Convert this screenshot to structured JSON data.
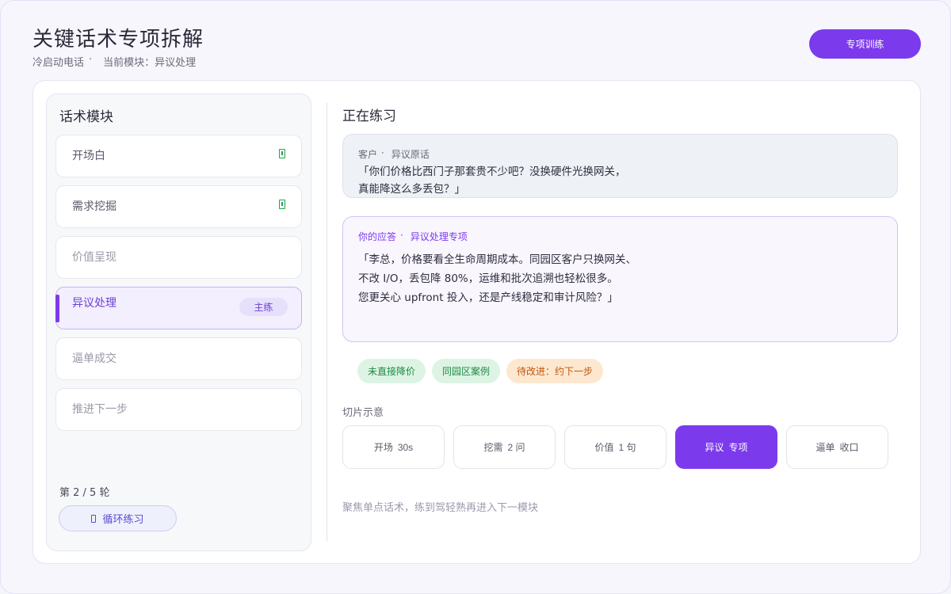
{
  "header": {
    "title": "关键话术专项拆解",
    "breadcrumb": [
      "冷启动电话",
      "当前模块：异议处理"
    ],
    "breadcrumb_sep": "·",
    "train_button": "专项训练"
  },
  "sidebar": {
    "title": "话术模块",
    "items": [
      {
        "label": "开场白",
        "state": "done",
        "icon": "phone-check-icon"
      },
      {
        "label": "需求挖掘",
        "state": "done",
        "icon": "phone-check-icon"
      },
      {
        "label": "价值呈现",
        "state": "pending"
      },
      {
        "label": "异议处理",
        "state": "active",
        "badge": "主练"
      },
      {
        "label": "逼单成交",
        "state": "pending"
      },
      {
        "label": "推进下一步",
        "state": "pending"
      }
    ],
    "round": "第 2 / 5 轮",
    "loop_button": "循环练习",
    "loop_icon": "phone-icon"
  },
  "practice": {
    "title": "正在练习",
    "customer": {
      "speaker": "客户",
      "sep": "·",
      "type": "异议原话",
      "lines": [
        "「你们价格比西门子那套贵不少吧？没换硬件光换网关，",
        "真能降这么多丢包？」"
      ]
    },
    "answer": {
      "speaker": "你的应答",
      "sep": "·",
      "type": "异议处理专项",
      "lines": [
        "「李总，价格要看全生命周期成本。同园区客户只换网关、",
        "不改 I/O，丢包降 80%，运维和批次追溯也轻松很多。",
        "您更关心 upfront 投入，还是产线稳定和审计风险？」"
      ]
    },
    "tags": [
      {
        "label": "未直接降价",
        "color": "green"
      },
      {
        "label": "同园区案例",
        "color": "green"
      },
      {
        "label": "待改进：约下一步",
        "color": "orange"
      }
    ],
    "slice_title": "切片示意",
    "slices": [
      {
        "a": "开场",
        "b": "30s"
      },
      {
        "a": "挖需",
        "b": "2 问"
      },
      {
        "a": "价值",
        "b": "1 句"
      },
      {
        "a": "异议",
        "b": "专项",
        "active": true
      },
      {
        "a": "逼单",
        "b": "收口"
      }
    ],
    "footer": "聚焦单点话术，练到驾轻熟再进入下一模块"
  },
  "colors": {
    "accent": "#7c3aed",
    "success": "#22a34a",
    "warning": "#c2570c"
  }
}
